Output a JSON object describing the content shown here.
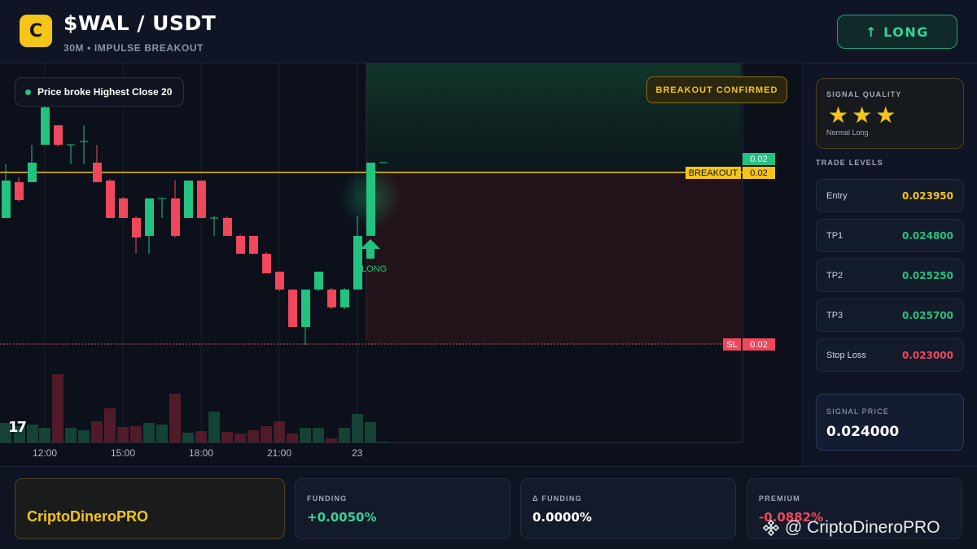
{
  "header": {
    "logo_letter": "C",
    "title": "$WAL / USDT",
    "subtitle": "30M • IMPULSE BREAKOUT",
    "long_button": "↑ LONG"
  },
  "chart": {
    "indicator_pill": "Price broke Highest Close 20",
    "breakout_badge": "BREAKOUT CONFIRMED",
    "current_price_tag": "0.02",
    "breakout_label": "BREAKOUT",
    "breakout_value": "0.02",
    "sl_label": "SL",
    "sl_value": "0.02",
    "long_marker_label": "LONG",
    "tv_logo": "17",
    "time_axis": [
      "12:00",
      "15:00",
      "18:00",
      "21:00",
      "23"
    ],
    "colors": {
      "up": "#22c27f",
      "down": "#f0475c",
      "breakout": "#f5c518",
      "sl": "#f0475c"
    }
  },
  "sidebar": {
    "signal_quality_label": "SIGNAL QUALITY",
    "stars": "★★★",
    "stars_count": 3,
    "quality_sub": "Normal Long",
    "trade_levels_label": "TRADE LEVELS",
    "levels": [
      {
        "name": "Entry",
        "value": "0.023950",
        "color": "#f5c518"
      },
      {
        "name": "TP1",
        "value": "0.024800",
        "color": "#22c27f"
      },
      {
        "name": "TP2",
        "value": "0.025250",
        "color": "#22c27f"
      },
      {
        "name": "TP3",
        "value": "0.025700",
        "color": "#22c27f"
      },
      {
        "name": "Stop Loss",
        "value": "0.023000",
        "color": "#f0475c"
      }
    ],
    "signal_price_label": "SIGNAL PRICE",
    "signal_price_value": "0.024000"
  },
  "footer": {
    "brand": "CriptoDineroPRO",
    "metrics": [
      {
        "label": "FUNDING",
        "value": "+0.0050%",
        "color": "#35d49a"
      },
      {
        "label": "Δ FUNDING",
        "value": "0.0000%",
        "color": "#ffffff"
      },
      {
        "label": "PREMIUM",
        "value": "-0.0882%",
        "color": "#f0475c"
      }
    ],
    "watermark": "@ CriptoDineroPRO"
  }
}
